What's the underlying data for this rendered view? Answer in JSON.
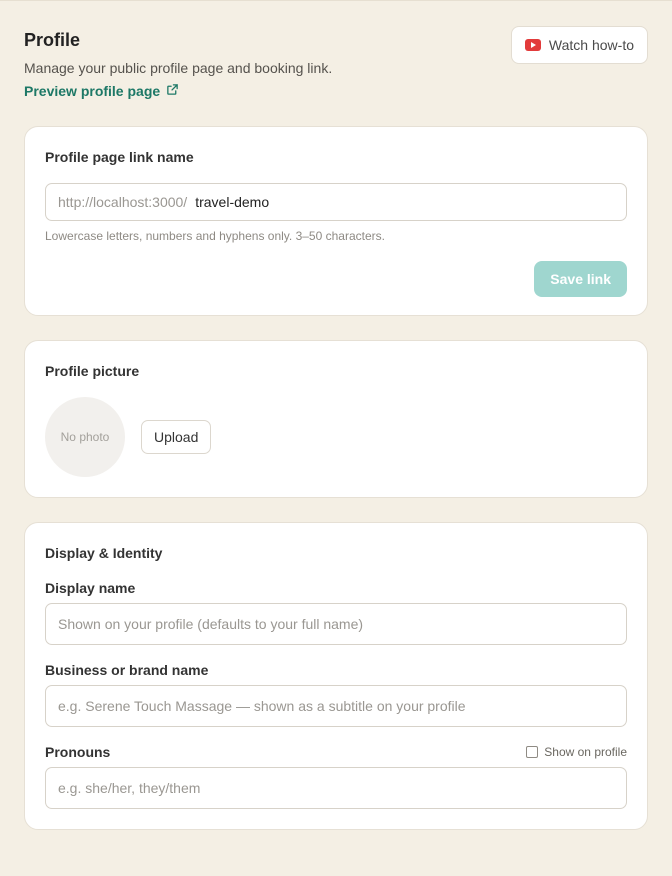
{
  "header": {
    "title": "Profile",
    "subtitle": "Manage your public profile page and booking link.",
    "preview_link": "Preview profile page",
    "watch_button": "Watch how-to"
  },
  "link_card": {
    "title": "Profile page link name",
    "prefix": "http://localhost:3000/",
    "value": "travel-demo",
    "hint": "Lowercase letters, numbers and hyphens only. 3–50 characters.",
    "save_label": "Save link"
  },
  "picture_card": {
    "title": "Profile picture",
    "placeholder": "No photo",
    "upload_label": "Upload"
  },
  "identity_card": {
    "title": "Display & Identity",
    "display_name": {
      "label": "Display name",
      "placeholder": "Shown on your profile (defaults to your full name)"
    },
    "business_name": {
      "label": "Business or brand name",
      "placeholder": "e.g. Serene Touch Massage — shown as a subtitle on your profile"
    },
    "pronouns": {
      "label": "Pronouns",
      "placeholder": "e.g. she/her, they/them",
      "show_on_profile_label": "Show on profile",
      "show_on_profile_checked": false
    }
  },
  "colors": {
    "background": "#f4efe4",
    "accent": "#1d7866",
    "save_disabled": "#9fd6cf",
    "youtube_red": "#e23b3b"
  }
}
